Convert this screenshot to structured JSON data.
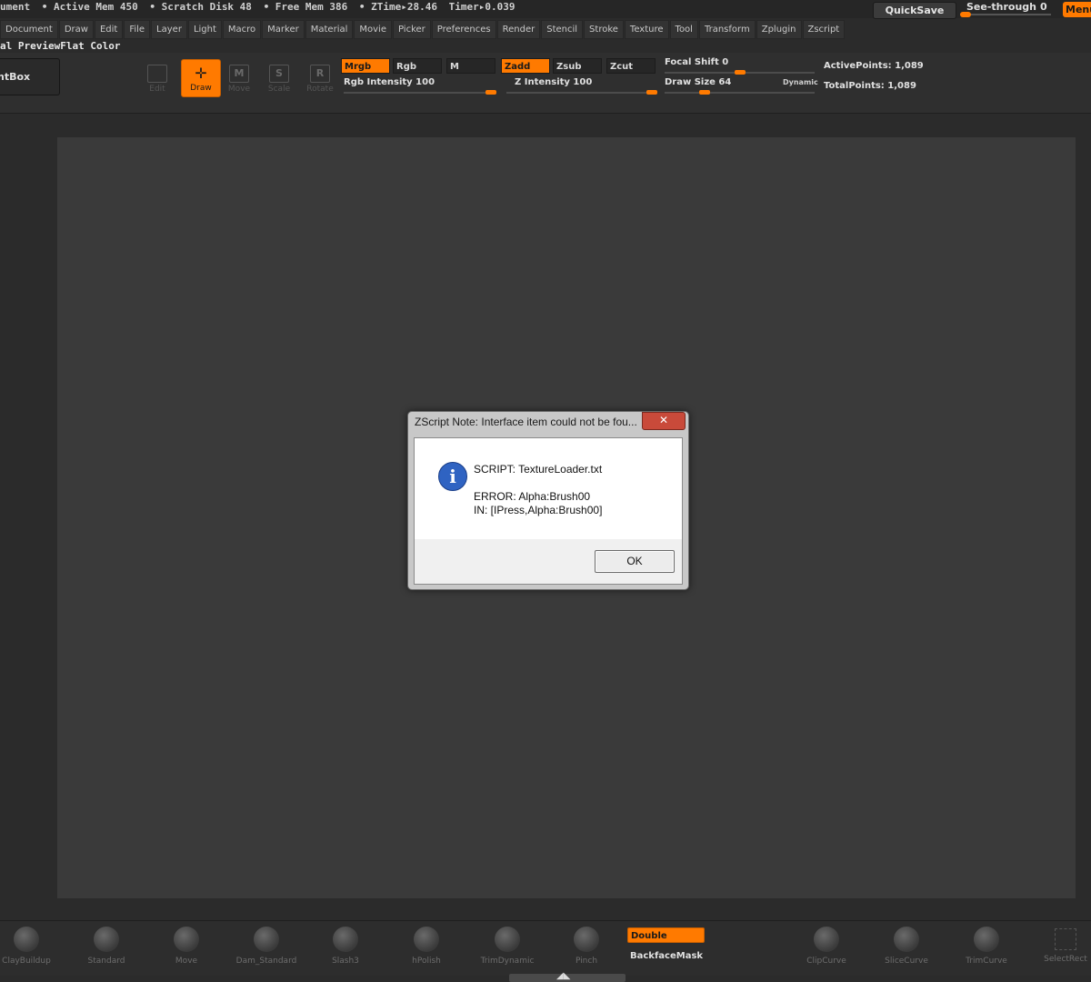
{
  "status": {
    "items": [
      "ument",
      "• Active Mem 450",
      "• Scratch Disk 48",
      "• Free Mem 386",
      "• ZTime▸28.46",
      "Timer▸0.039"
    ],
    "quicksave_label": "QuickSave",
    "seethrough_label": "See-through",
    "seethrough_value": "0",
    "seethrough_level": 0,
    "menus_label": "Menu"
  },
  "menubar": [
    "Document",
    "Draw",
    "Edit",
    "File",
    "Layer",
    "Light",
    "Macro",
    "Marker",
    "Material",
    "Movie",
    "Picker",
    "Preferences",
    "Render",
    "Stencil",
    "Stroke",
    "Texture",
    "Tool",
    "Transform",
    "Zplugin",
    "Zscript"
  ],
  "preview_line": "al PreviewFlat Color",
  "shelf": {
    "lightbox_label": "htBox",
    "tools": {
      "edit": {
        "label": "Edit",
        "glyph": ""
      },
      "draw": {
        "label": "Draw",
        "glyph": "✛"
      },
      "move": {
        "label": "Move",
        "glyph": "M"
      },
      "scale": {
        "label": "Scale",
        "glyph": "S"
      },
      "rotate": {
        "label": "Rotate",
        "glyph": "R"
      }
    },
    "modes": {
      "mrgb": "Mrgb",
      "rgb": "Rgb",
      "m": "M",
      "zadd": "Zadd",
      "zsub": "Zsub",
      "zcut": "Zcut"
    },
    "rgb_intensity": {
      "label": "Rgb Intensity 100",
      "value": 100
    },
    "z_intensity": {
      "label": "Z Intensity 100",
      "value": 100
    },
    "focal_shift": {
      "label": "Focal Shift 0",
      "value": 0
    },
    "draw_size": {
      "label": "Draw Size 64",
      "value": 64
    },
    "dynamic_label": "Dynamic",
    "active_points": "ActivePoints: 1,089",
    "total_points": "TotalPoints: 1,089"
  },
  "dialog": {
    "title": "ZScript Note: Interface item could not be fou...",
    "close_glyph": "✕",
    "icon_glyph": "i",
    "script_line": "SCRIPT: TextureLoader.txt",
    "error_line": "ERROR: Alpha:Brush00",
    "in_line": "IN: [IPress,Alpha:Brush00]",
    "ok_label": "OK"
  },
  "brushes": {
    "claybuildup": "ClayBuildup",
    "standard": "Standard",
    "move": "Move",
    "dam_standard": "Dam_Standard",
    "slash3": "Slash3",
    "hpolish": "hPolish",
    "trimdynamic": "TrimDynamic",
    "pinch": "Pinch",
    "clipcurve": "ClipCurve",
    "slicecurve": "SliceCurve",
    "trimcurve": "TrimCurve",
    "selectrect": "SelectRect"
  },
  "double_label": "Double",
  "backface_label": "BackfaceMask",
  "collapse_glyph": "◢◣"
}
